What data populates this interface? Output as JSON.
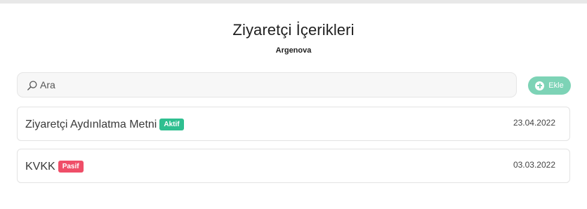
{
  "header": {
    "title": "Ziyaretçi İçerikleri",
    "subtitle": "Argenova"
  },
  "search": {
    "placeholder": "Ara",
    "icon": "search-icon"
  },
  "toolbar": {
    "add_label": "Ekle",
    "add_icon": "plus-circle-icon",
    "add_color": "#7dd3b6"
  },
  "items": [
    {
      "title": "Ziyaretçi Aydınlatma Metni",
      "status": "Aktif",
      "status_color": "#2fbf90",
      "date": "23.04.2022"
    },
    {
      "title": "KVKK",
      "status": "Pasif",
      "status_color": "#ef4e68",
      "date": "03.03.2022"
    }
  ]
}
